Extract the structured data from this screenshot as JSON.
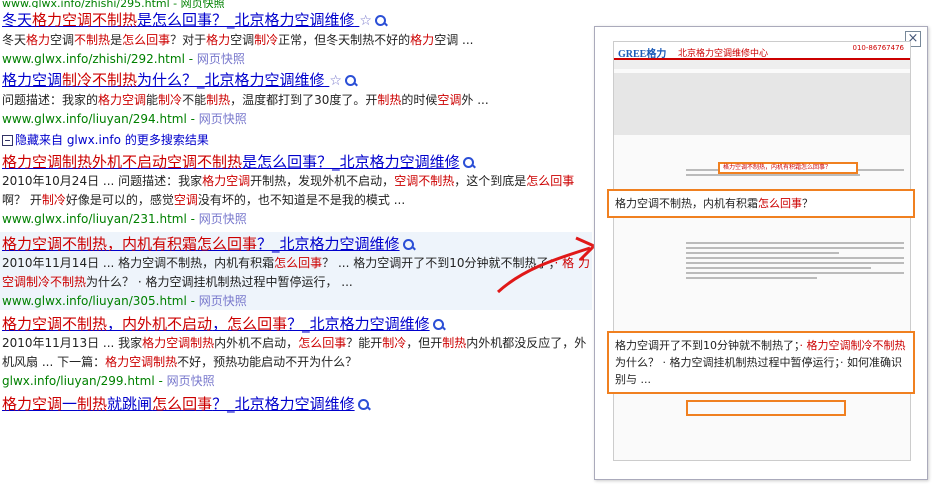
{
  "top_clip": "www.glwx.info/zhishi/295.html - 网页快照",
  "results": [
    {
      "title_parts": [
        "冬天",
        "格力空调",
        "不制热",
        "是怎么回事？_北京格力空调维修"
      ],
      "desc_parts": [
        "冬天",
        "格力",
        "空调",
        "不制热",
        "是",
        "怎么回事",
        "？对于",
        "格力",
        "空调",
        "制冷",
        "正常，但冬天制热不好的",
        "格力",
        "空调 ..."
      ],
      "url": "www.glwx.info/zhishi/292.html",
      "snapshot": "网页快照",
      "star": true
    },
    {
      "title_parts": [
        "格力空调",
        "制冷不制热",
        "为什么？_北京格力空调维修"
      ],
      "desc_parts": [
        "问题描述：我家的",
        "格力空调",
        "能",
        "制冷",
        "不能",
        "制热",
        "，温度都打到了30度了。开",
        "制热",
        "的时候",
        "空调",
        "外 ..."
      ],
      "url": "www.glwx.info/liuyan/294.html",
      "snapshot": "网页快照",
      "star": true
    },
    {
      "title_parts": [
        "格力空调",
        "制热外机不启动",
        "空调",
        "不制热",
        "是怎么回事？_北京格力空调维修"
      ],
      "desc_parts": [
        "2010年10月24日 ... 问题描述：我家",
        "格力空调",
        "开制热，发现外机不启动，",
        "空调",
        "不制热",
        "，这个到底是",
        "怎么回事",
        "啊？ 开",
        "制冷",
        "好像是可以的，感觉",
        "空调",
        "没有坏的，也不知道是不是我的模式 ..."
      ],
      "url": "www.glwx.info/liuyan/231.html",
      "snapshot": "网页快照",
      "star": false
    },
    {
      "title_parts": [
        "格力空调",
        "不制热，内机有积霜",
        "怎么回事",
        "？_北京格力空调维修"
      ],
      "desc_parts": [
        "2010年11月14日 ... 格力空调不制热，内机有积霜",
        "怎么回事",
        "？ ... 格力空调开了不到10分钟就不制热了；",
        "· 格 力空调制冷不制热",
        "为什么？ · 格力空调挂机制热过程中暂停运行， ..."
      ],
      "url": "www.glwx.info/liuyan/305.html",
      "snapshot": "网页快照",
      "star": false
    },
    {
      "title_parts": [
        "格力空调",
        "不制热",
        "，",
        "内外机不启动",
        "，",
        "怎么回事",
        "？_北京格力空调维修"
      ],
      "desc_parts": [
        "2010年11月13日 ... 我家",
        "格力空调制热",
        "内外机不启动，",
        "怎么回事",
        "？能开",
        "制冷",
        "，但开",
        "制热",
        "内外机都没反应了，外机风扇 ... 下一篇：",
        "格力空调",
        "制热",
        "不好，预热功能启动不开为什么？"
      ],
      "url": "glwx.info/liuyan/299.html",
      "snapshot": "网页快照",
      "star": false
    },
    {
      "title_parts": [
        "格力空调",
        "一",
        "制热",
        "就跳闸",
        "怎么回事",
        "？_北京格力空调维修"
      ],
      "desc_parts": [],
      "url": "",
      "snapshot": "",
      "star": false
    }
  ],
  "more_results": "隐藏来自 glwx.info 的更多搜索结果",
  "preview": {
    "close": "×",
    "logo": "GREE格力",
    "site_name": "北京格力空调维修中心",
    "phone": "010-86767476",
    "thumb_highlight": "格力空调不制热，内机有积霜怎么回事？",
    "callout1_parts": [
      "格力空调不制热，内机有积霜",
      "怎么回事",
      "？"
    ],
    "callout2_parts": [
      "格力空调开了不到10分钟就不制热了；",
      "· 格力空调制冷不制热",
      "为什么？ · 格力空调挂机制热过程中暂停运行；· 如何准确识别与 ..."
    ]
  },
  "colors": {
    "link": "#0000cc",
    "highlight": "#cc0000",
    "url": "#008000",
    "callout_border": "#f08020"
  }
}
